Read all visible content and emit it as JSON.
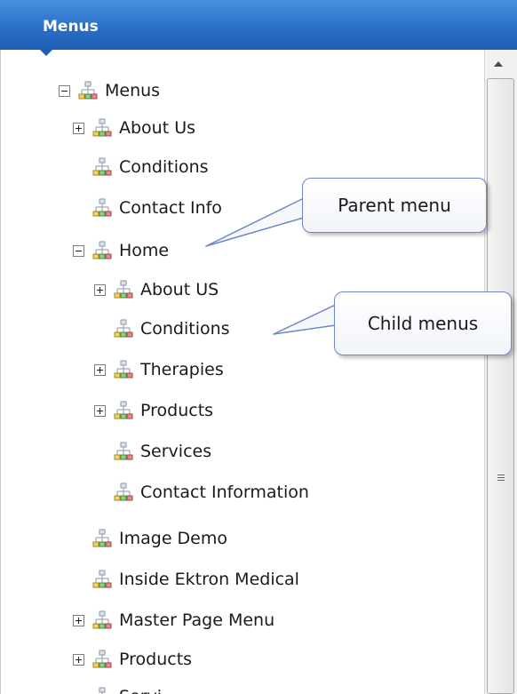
{
  "panel": {
    "title": "Menus"
  },
  "tree": [
    {
      "label": "Menus",
      "toggle": "minus"
    },
    {
      "label": "About Us",
      "toggle": "plus"
    },
    {
      "label": "Conditions",
      "toggle": "none"
    },
    {
      "label": "Contact Info",
      "toggle": "none"
    },
    {
      "label": "Home",
      "toggle": "minus"
    },
    {
      "label": "About US",
      "toggle": "plus"
    },
    {
      "label": "Conditions",
      "toggle": "none"
    },
    {
      "label": "Therapies",
      "toggle": "plus"
    },
    {
      "label": "Products",
      "toggle": "plus"
    },
    {
      "label": "Services",
      "toggle": "none"
    },
    {
      "label": "Contact Information",
      "toggle": "none"
    },
    {
      "label": "Image Demo",
      "toggle": "none"
    },
    {
      "label": "Inside Ektron Medical",
      "toggle": "none"
    },
    {
      "label": "Master Page Menu",
      "toggle": "plus"
    },
    {
      "label": "Products",
      "toggle": "plus"
    },
    {
      "label": "Servi",
      "toggle": "none"
    }
  ],
  "callouts": {
    "parent": "Parent menu",
    "child": "Child menus"
  },
  "colors": {
    "header": "#2a6fc8",
    "callout_border": "#6f87c8"
  },
  "icons": {
    "tree_node": "sitemap-icon",
    "expand": "plus-box-icon",
    "collapse": "minus-box-icon"
  }
}
